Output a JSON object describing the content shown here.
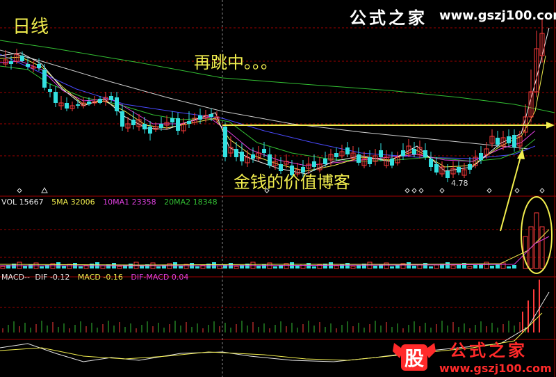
{
  "chart": {
    "period_label": "日线",
    "annotation_top": "再跳中。。。",
    "annotation_mid": "金钱的价值博客",
    "low_price_label": "4.78"
  },
  "volume_panel": {
    "vol_label": "VOL 15667",
    "ma5_label": "5MA 32006",
    "ma10_label": "10MA1 23358",
    "ma20_label": "20MA2 18348"
  },
  "macd_panel": {
    "name_label": "MACD--",
    "dif_label": "DIF -0.12",
    "macd_label": "MACD -0.16",
    "difmacd_label": "DIF-MACD 0.04"
  },
  "branding": {
    "site_name": "公式之家",
    "site_url": "www.gszj100.com",
    "logo_char": "股",
    "watermark_name": "公式之家",
    "watermark_url": "www.gszj100.com"
  },
  "colors": {
    "background": "#000000",
    "up_candle": "#ff3b3b",
    "down_candle": "#33e0e0",
    "ma_white": "#e8e8e8",
    "ma_yellow": "#f2ee4e",
    "ma_magenta": "#e040e0",
    "ma_green": "#33c033",
    "ma_blue": "#4a4aff",
    "grid_red": "#a00000"
  }
}
